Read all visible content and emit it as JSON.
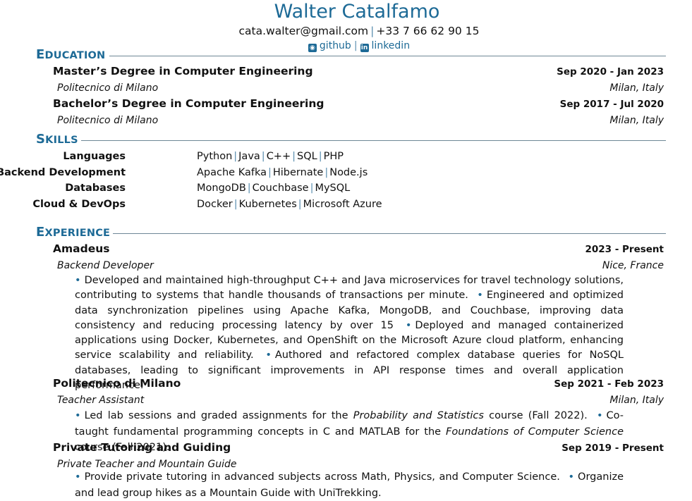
{
  "header": {
    "name": "Walter Catalfamo",
    "email": "cata.walter@gmail.com",
    "phone": "+33 7 66 62 90 15",
    "separator": "|",
    "github_label": "github",
    "github_icon": "github-icon",
    "linkedin_label": "linkedin",
    "linkedin_icon": "linkedin-icon",
    "accent_color": "#1d6a96"
  },
  "sections": {
    "education": {
      "first": "E",
      "rest": "DUCATION"
    },
    "skills": {
      "first": "S",
      "rest": "KILLS"
    },
    "experience": {
      "first": "E",
      "rest": "XPERIENCE"
    }
  },
  "education": [
    {
      "degree": "Master’s Degree in Computer Engineering",
      "dates": "Sep 2020 - Jan 2023",
      "school": "Politecnico di Milano",
      "location": "Milan, Italy"
    },
    {
      "degree": "Bachelor’s Degree in Computer Engineering",
      "dates": "Sep 2017 - Jul 2020",
      "school": "Politecnico di Milano",
      "location": "Milan, Italy"
    }
  ],
  "skills": [
    {
      "category": "Languages",
      "items": [
        "Python",
        "Java",
        "C++",
        "SQL",
        "PHP"
      ]
    },
    {
      "category": "Backend Development",
      "items": [
        "Apache Kafka",
        "Hibernate",
        "Node.js"
      ]
    },
    {
      "category": "Databases",
      "items": [
        "MongoDB",
        "Couchbase",
        "MySQL"
      ]
    },
    {
      "category": "Cloud & DevOps",
      "items": [
        "Docker",
        "Kubernetes",
        "Microsoft Azure"
      ]
    }
  ],
  "experience": [
    {
      "company": "Amadeus",
      "dates": "2023 - Present",
      "role": "Backend Developer",
      "location": "Nice, France",
      "bullets": [
        "Developed and maintained high-throughput C++ and Java microservices for travel technology solutions, contributing to systems that handle thousands of transactions per minute.",
        "Engineered and optimized data synchronization pipelines using Apache Kafka, MongoDB, and Couchbase, improving data consistency and reducing processing latency by over 15",
        "Deployed and managed containerized applications using Docker, Kubernetes, and OpenShift on the Microsoft Azure cloud platform, enhancing service scalability and reliability.",
        "Authored and refactored complex database queries for NoSQL databases, leading to significant improvements in API response times and overall application performance."
      ]
    },
    {
      "company": "Politecnico di Milano",
      "dates": "Sep 2021 - Feb 2023",
      "role": "Teacher Assistant",
      "location": "Milan, Italy",
      "bullets": [
        {
          "pre": "Led lab sessions and graded assignments for the ",
          "em": "Probability and Statistics",
          "post": " course (Fall 2022)."
        },
        {
          "pre": "Co-taught fundamental programming concepts in C and MATLAB for the ",
          "em": "Foundations of Computer Science",
          "post": " course (Fall 2021)."
        }
      ]
    },
    {
      "company": "Private Tutoring and Guiding",
      "dates": "Sep 2019 - Present",
      "role": "Private Teacher and Mountain Guide",
      "location": "",
      "bullets": [
        "Provide private tutoring in advanced subjects across Math, Physics, and Computer Science.",
        "Organize and lead group hikes as a Mountain Guide with UniTrekking."
      ]
    }
  ],
  "bullet_glyph": "•"
}
